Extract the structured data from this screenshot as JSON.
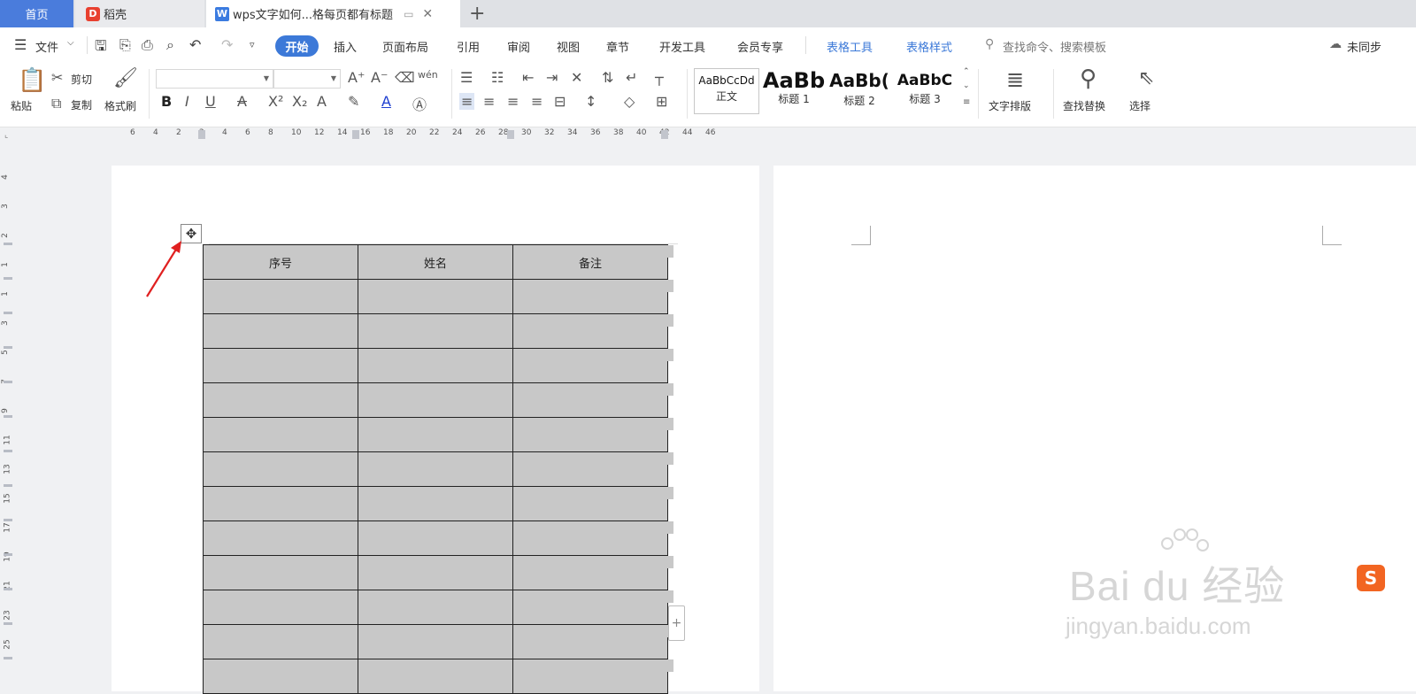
{
  "tabs": {
    "home": "首页",
    "daoke": "稻壳",
    "document": "wps文字如何...格每页都有标题"
  },
  "menu": {
    "file": "文件",
    "start": "开始",
    "items": [
      "插入",
      "页面布局",
      "引用",
      "审阅",
      "视图",
      "章节",
      "开发工具",
      "会员专享"
    ],
    "table_tools": "表格工具",
    "table_style": "表格样式",
    "search_placeholder": "查找命令、搜索模板",
    "sync": "未同步"
  },
  "ribbon": {
    "paste": "粘贴",
    "cut": "剪切",
    "copy": "复制",
    "format_painter": "格式刷",
    "styles": [
      {
        "sample": "AaBbCcDd",
        "name": "正文"
      },
      {
        "sample": "AaBb",
        "name": "标题 1"
      },
      {
        "sample": "AaBb(",
        "name": "标题 2"
      },
      {
        "sample": "AaBbC",
        "name": "标题 3"
      }
    ],
    "text_layout": "文字排版",
    "find_replace": "查找替换",
    "select": "选择"
  },
  "ruler": {
    "h_ticks": [
      "6",
      "4",
      "2",
      "2",
      "4",
      "6",
      "8",
      "10",
      "12",
      "14",
      "16",
      "18",
      "20",
      "22",
      "24",
      "26",
      "28",
      "30",
      "32",
      "34",
      "36",
      "38",
      "40",
      "42",
      "44",
      "46"
    ],
    "v_ticks": [
      "4",
      "3",
      "2",
      "1",
      "1",
      "3",
      "5",
      "7",
      "9",
      "11",
      "13",
      "15",
      "17",
      "19",
      "21",
      "23",
      "25"
    ]
  },
  "table": {
    "headers": [
      "序号",
      "姓名",
      "备注"
    ],
    "empty_rows": 12
  },
  "watermark": {
    "main": "Bai du 经验",
    "sub": "jingyan.baidu.com"
  },
  "colors": {
    "accent": "#3c79d8",
    "table_fill": "#c8c8c8",
    "arrow": "#e02020"
  }
}
